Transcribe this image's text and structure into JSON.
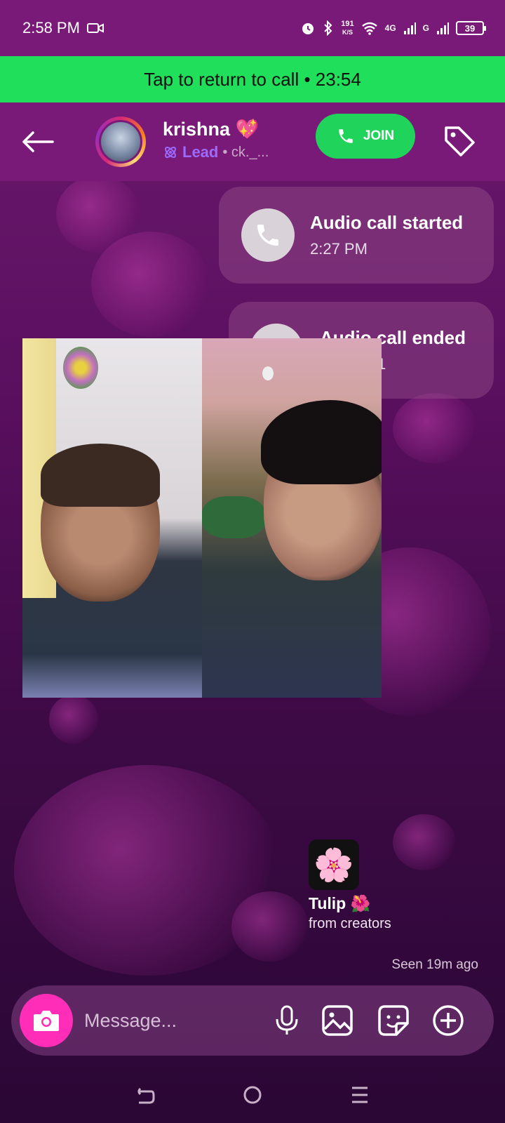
{
  "status_bar": {
    "time": "2:58 PM",
    "net_speed_top": "191",
    "net_speed_bottom": "K/S",
    "network_4g": "4G",
    "network_g": "G",
    "battery": "39"
  },
  "call_banner": {
    "text": "Tap to return to call • 23:54"
  },
  "header": {
    "name": "krishna 💖",
    "badge": "Lead",
    "handle": "• ck._...",
    "join_label": "JOIN"
  },
  "messages": {
    "call_started": {
      "title": "Audio call started",
      "time": "2:27 PM"
    },
    "call_ended": {
      "title": "Audio call ended",
      "time": "1"
    }
  },
  "sticker": {
    "emoji": "🌸",
    "name": "Tulip 🌺",
    "source": "from creators"
  },
  "seen": "Seen 19m ago",
  "composer": {
    "placeholder": "Message..."
  },
  "colors": {
    "banner": "#20e05b",
    "join": "#20d35a",
    "camera": "#ff2db8",
    "header": "#7a1a78",
    "lead": "#9b6bff"
  },
  "icons": [
    "back-arrow-icon",
    "phone-icon",
    "tag-icon",
    "camera-icon",
    "microphone-icon",
    "gallery-icon",
    "sticker-icon",
    "plus-icon",
    "nav-back-icon",
    "nav-home-icon",
    "nav-menu-icon"
  ]
}
